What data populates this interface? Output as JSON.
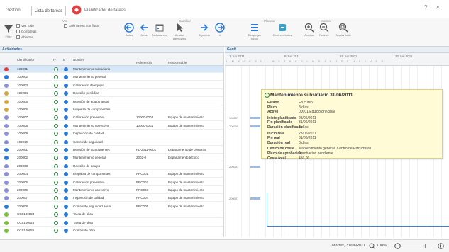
{
  "tabs": [
    {
      "label": "Gestión",
      "active": false
    },
    {
      "label": "Lista de tareas",
      "active": true
    },
    {
      "label": "Planificador de tareas",
      "active": false
    }
  ],
  "window": {
    "help": "?",
    "close": "✕"
  },
  "ribbon": {
    "groups": [
      "Ver",
      "Cambiar",
      "Planear",
      "Mostrar"
    ],
    "filter_label": "Filtro",
    "checks": [
      "Ver Todo",
      "Completas",
      "Abiertas"
    ],
    "item_filter": "Sólo tareas con filtros",
    "actions": [
      "Antes",
      "Atrás",
      "Fecha ahora",
      "Ajustar calendario",
      "Siguiente",
      "Ir",
      "Desplegar todos",
      "Contraer todos",
      "Ampliar",
      "Reducir",
      "Ajustar todo"
    ]
  },
  "panels": {
    "left": "Actividades",
    "right": "Gantt"
  },
  "table": {
    "headers": {
      "id": "Identificador",
      "ty": "Ty",
      "st": "E",
      "name": "Nombre",
      "ref": "Referencia",
      "resp": "Responsable"
    },
    "rows": [
      {
        "id": "100001",
        "name": "Mantenimiento subsidiario",
        "ref": "",
        "resp": "",
        "color": "#e04040",
        "sel": true
      },
      {
        "id": "100002",
        "name": "Mantenimiento general",
        "ref": "",
        "resp": "",
        "color": "#2b7bd6",
        "sel": false
      },
      {
        "id": "100003",
        "name": "Calibración de equipo",
        "ref": "",
        "resp": "",
        "color": "#8a8fd8",
        "sel": false
      },
      {
        "id": "100004",
        "name": "Revisión periódica",
        "ref": "",
        "resp": "",
        "color": "#d6a63d",
        "sel": false
      },
      {
        "id": "100005",
        "name": "Revisión de equipo anual",
        "ref": "",
        "resp": "",
        "color": "#d6a63d",
        "sel": false
      },
      {
        "id": "100006",
        "name": "Limpieza de componentes",
        "ref": "",
        "resp": "",
        "color": "#d6a63d",
        "sel": false
      },
      {
        "id": "100007",
        "name": "Calibración preventiva",
        "ref": "10000-0001",
        "resp": "Equipo de mantenimiento",
        "color": "#8a8fd8",
        "sel": false
      },
      {
        "id": "100008",
        "name": "Mantenimiento correctivo",
        "ref": "10000-0002",
        "resp": "Equipo de mantenimiento",
        "color": "#8a8fd8",
        "sel": false
      },
      {
        "id": "100009",
        "name": "Inspección de calidad",
        "ref": "",
        "resp": "",
        "color": "#8a8fd8",
        "sel": false
      },
      {
        "id": "100010",
        "name": "Control de seguridad",
        "ref": "",
        "resp": "",
        "color": "#8a8fd8",
        "sel": false
      },
      {
        "id": "200001",
        "name": "Revisión de componentes",
        "ref": "PL-2011-0001",
        "resp": "Departamento de compras",
        "color": "#2b7bd6",
        "sel": false
      },
      {
        "id": "200002",
        "name": "Mantenimiento general",
        "ref": "2002-0",
        "resp": "Departamento técnico",
        "color": "#2b7bd6",
        "sel": false
      },
      {
        "id": "200003",
        "name": "Revisión de equipo",
        "ref": "",
        "resp": "",
        "color": "#8a8fd8",
        "sel": false
      },
      {
        "id": "200004",
        "name": "Limpieza de componentes",
        "ref": "PRC001",
        "resp": "Equipo de mantenimiento",
        "color": "#8a8fd8",
        "sel": false
      },
      {
        "id": "200005",
        "name": "Calibración preventiva",
        "ref": "PRC002",
        "resp": "Equipo de mantenimiento",
        "color": "#8a8fd8",
        "sel": false
      },
      {
        "id": "200006",
        "name": "Mantenimiento correctivo",
        "ref": "PRC003",
        "resp": "Equipo de mantenimiento",
        "color": "#8a8fd8",
        "sel": false
      },
      {
        "id": "200007",
        "name": "Inspección de calidad",
        "ref": "PRC004",
        "resp": "Equipo de mantenimiento",
        "color": "#8a8fd8",
        "sel": false
      },
      {
        "id": "200008",
        "name": "Control de seguridad anual",
        "ref": "PRC005",
        "resp": "Equipo de mantenimiento",
        "color": "#2b7bd6",
        "sel": false
      },
      {
        "id": "CG0100024",
        "name": "Tarea de obra",
        "ref": "",
        "resp": "",
        "color": "#7bbf3a",
        "sel": false
      },
      {
        "id": "CG0100025",
        "name": "Tarea de obra",
        "ref": "",
        "resp": "",
        "color": "#7bbf3a",
        "sel": false
      },
      {
        "id": "CG0100026",
        "name": "Control de obra",
        "ref": "",
        "resp": "",
        "color": "#7bbf3a",
        "sel": false
      }
    ]
  },
  "gantt": {
    "weeks": [
      "1 Jun 2011",
      "8 Jun 2011",
      "15 Jun 2011",
      "22 Jun 2011"
    ],
    "day_letters": "LMXJVSDLMXJVSDLMXJVSDLMXJVSD",
    "bars": [
      {
        "row": 6,
        "label": "100007"
      },
      {
        "row": 7,
        "label": "100008"
      },
      {
        "row": 12,
        "label": "200003"
      },
      {
        "row": 16,
        "label": "200007"
      }
    ]
  },
  "tooltip": {
    "title": "Mantenimiento subsidiario 31/06/2011",
    "fields": [
      {
        "k": "Estado",
        "v": "En curso"
      },
      {
        "k": "Plazo",
        "v": "8 días"
      },
      {
        "k": "Activo",
        "v": "00001 Equipo principal"
      },
      {
        "k": "Inicio planificado",
        "v": "23/05/2011"
      },
      {
        "k": "Fin planificado",
        "v": "31/06/2011"
      },
      {
        "k": "Duración planificada",
        "v": "8 días"
      },
      {
        "k": "Inicio real",
        "v": "23/05/2011"
      },
      {
        "k": "Fin real",
        "v": "31/06/2011"
      },
      {
        "k": "Duración real",
        "v": "8 días"
      },
      {
        "k": "Centro de coste",
        "v": "Mantenimiento general. Centro de Estructuras"
      },
      {
        "k": "Plazo de aprobación",
        "v": "Aprobación pendiente"
      },
      {
        "k": "Coste total",
        "v": "450,00"
      }
    ]
  },
  "status": {
    "date": "Martes, 31/06/2011",
    "zoom_label": "100%"
  }
}
